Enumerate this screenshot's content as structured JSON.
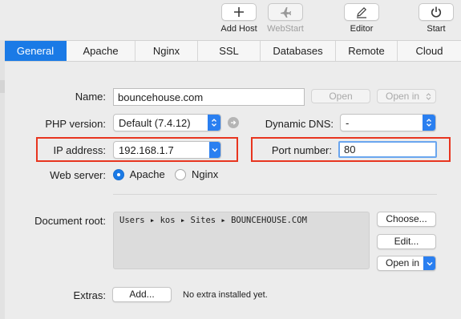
{
  "toolbar": {
    "add_host": {
      "label": "Add Host",
      "icon": "plus-icon"
    },
    "webstart": {
      "label": "WebStart",
      "icon": "airplane-icon",
      "enabled": false
    },
    "editor": {
      "label": "Editor",
      "icon": "pencil-icon"
    },
    "start": {
      "label": "Start",
      "icon": "power-icon"
    }
  },
  "tabs": [
    {
      "label": "General",
      "active": true
    },
    {
      "label": "Apache"
    },
    {
      "label": "Nginx"
    },
    {
      "label": "SSL"
    },
    {
      "label": "Databases"
    },
    {
      "label": "Remote"
    },
    {
      "label": "Cloud"
    }
  ],
  "form": {
    "name_label": "Name:",
    "name_value": "bouncehouse.com",
    "open_button": "Open",
    "open_in_button": "Open in",
    "php_label": "PHP version:",
    "php_value": "Default (7.4.12)",
    "dynamic_dns_label": "Dynamic DNS:",
    "dynamic_dns_value": "-",
    "ip_label": "IP address:",
    "ip_value": "192.168.1.7",
    "port_label": "Port number:",
    "port_value": "80",
    "web_server_label": "Web server:",
    "web_server_options": [
      "Apache",
      "Nginx"
    ],
    "web_server_selected": "Apache",
    "doc_root_label": "Document root:",
    "doc_root_path": "Users ▸ kos ▸ Sites ▸ BOUNCEHOUSE.COM",
    "choose_button": "Choose...",
    "edit_button": "Edit...",
    "open_in_bottom_button": "Open in",
    "extras_label": "Extras:",
    "add_button": "Add...",
    "extras_status": "No extra installed yet."
  },
  "colors": {
    "accent": "#1a7ae6",
    "highlight": "#e8351f"
  }
}
